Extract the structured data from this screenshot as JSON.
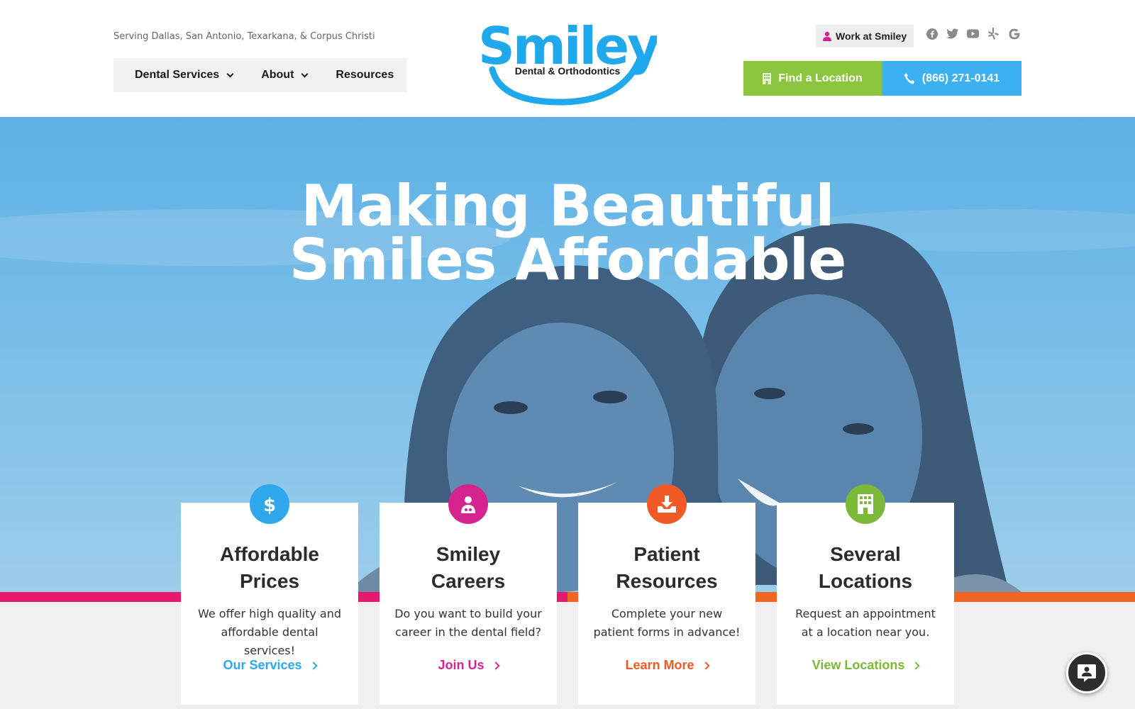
{
  "header": {
    "serving": "Serving Dallas, San Antonio, Texarkana, & Corpus Christi",
    "nav": [
      {
        "label": "Dental Services",
        "has_dropdown": true
      },
      {
        "label": "About",
        "has_dropdown": true
      },
      {
        "label": "Resources",
        "has_dropdown": false
      }
    ],
    "logo": {
      "word": "Smiley",
      "tagline": "Dental & Orthodontics"
    },
    "work_label": "Work at Smiley",
    "socials": [
      "facebook-icon",
      "twitter-icon",
      "youtube-icon",
      "yelp-icon",
      "google-icon"
    ],
    "find_label": "Find a Location",
    "phone_label": "(866) 271-0141"
  },
  "hero": {
    "line1": "Making Beautiful",
    "line2": "Smiles Affordable"
  },
  "cards": [
    {
      "title1": "Affordable",
      "title2": "Prices",
      "text": "We offer high quality and affordable dental services!",
      "link": "Our Services",
      "color": "#2ea7ec",
      "icon": "dollar-icon"
    },
    {
      "title1": "Smiley",
      "title2": "Careers",
      "text": "Do you want to build your career in the dental field?",
      "link": "Join Us",
      "color": "#d6248f",
      "icon": "doctor-icon"
    },
    {
      "title1": "Patient",
      "title2": "Resources",
      "text": "Complete your new patient forms in advance!",
      "link": "Learn More",
      "color": "#f15a24",
      "icon": "download-icon"
    },
    {
      "title1": "Several",
      "title2": "Locations",
      "text": "Request an appointment at a location near you.",
      "link": "View Locations",
      "color": "#7cb83a",
      "icon": "building-icon"
    }
  ],
  "colors": {
    "green": "#8cc63f",
    "blue": "#3cb0f0",
    "pink": "#e6196e",
    "orange": "#f26522"
  }
}
